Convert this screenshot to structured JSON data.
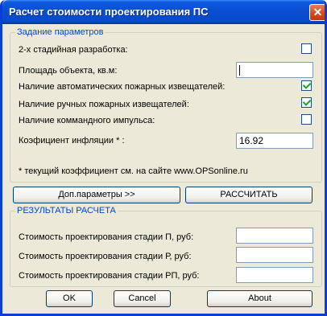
{
  "window": {
    "title": "Расчет стоимости проектирования ПС",
    "close_glyph": "✕"
  },
  "params": {
    "legend": "Задание параметров",
    "two_stage": {
      "label": "2-х стадийная разработка:",
      "checked": false
    },
    "area": {
      "label": "Площадь объекта, кв.м:",
      "value": ""
    },
    "auto_detectors": {
      "label": "Наличие автоматических пожарных извещателей:",
      "checked": true
    },
    "manual_detectors": {
      "label": "Наличие ручных пожарных извещателей:",
      "checked": true
    },
    "command_pulse": {
      "label": "Наличие коммандного импульса:",
      "checked": false
    },
    "inflation": {
      "label": "Коэфициент инфляции * :",
      "value": "16.92"
    },
    "note": "* текущий коэффициент см. на сайте www.OPSonline.ru"
  },
  "actions": {
    "more_params": "Доп.параметры >>",
    "calculate": "РАССЧИТАТЬ"
  },
  "results": {
    "legend": "РЕЗУЛЬТАТЫ РАСЧЕТА",
    "stage_p": {
      "label": "Стоимость проектирования стадии П, руб:",
      "value": ""
    },
    "stage_r": {
      "label": "Стоимость проектирования стадии Р, руб:",
      "value": ""
    },
    "stage_rp": {
      "label": "Стоимость проектирования стадии РП, руб:",
      "value": ""
    }
  },
  "footer": {
    "ok": "OK",
    "cancel": "Cancel",
    "about": "About"
  },
  "colors": {
    "titlebar": "#0a4acc",
    "dialog_bg": "#ece9d8",
    "legend_text": "#0046d5",
    "checkmark": "#21a121"
  }
}
